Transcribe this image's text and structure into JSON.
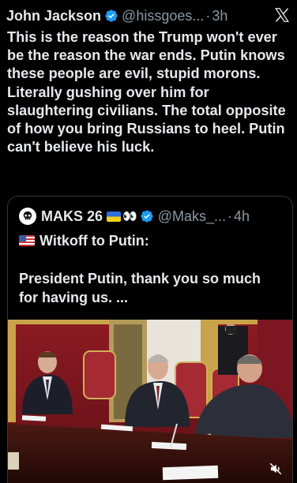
{
  "post": {
    "author_name": "John Jackson",
    "handle": "@hissgoes...",
    "separator": "·",
    "time": "3h",
    "text": "This is the reason the Trump won't ever be the reason the war ends. Putin knows these people are evil, stupid morons. Literally gushing over him for slaughtering civilians. The total opposite of how you bring Russians to heel. Putin can't believe his luck."
  },
  "quote": {
    "author_name": "MAKS 26",
    "handle": "@Maks_...",
    "separator": "·",
    "time": "4h",
    "line1": "Witkoff to Putin:",
    "line2": "President Putin, thank you so much for having us. ..."
  },
  "icons": {
    "verified": "verified-badge-icon",
    "x_logo": "x-logo-icon",
    "flag_ukraine": "ukraine-flag-icon",
    "eyes": "eyes-icon",
    "flag_us": "us-flag-icon",
    "mute": "muted-speaker-icon",
    "avatar": "skull-avatar"
  },
  "colors": {
    "background": "#000000",
    "text": "#e7e9ea",
    "secondary": "#8b98a5",
    "verified": "#1d9bf0",
    "border": "#333639"
  }
}
